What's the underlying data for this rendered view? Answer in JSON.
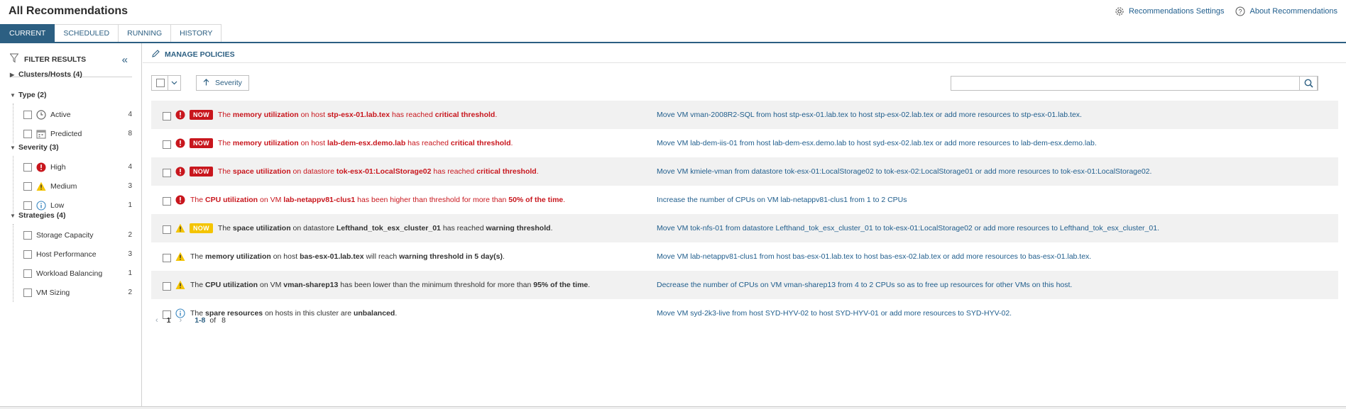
{
  "header": {
    "title": "All Recommendations",
    "settings_label": "Recommendations Settings",
    "about_label": "About Recommendations"
  },
  "tabs": [
    {
      "label": "CURRENT",
      "active": true
    },
    {
      "label": "SCHEDULED",
      "active": false
    },
    {
      "label": "RUNNING",
      "active": false
    },
    {
      "label": "HISTORY",
      "active": false
    }
  ],
  "sidebar": {
    "title": "FILTER RESULTS",
    "groups": [
      {
        "label": "Clusters/Hosts (4)",
        "expanded": false,
        "items": []
      },
      {
        "label": "Type (2)",
        "expanded": true,
        "items": [
          {
            "label": "Active",
            "count": "4",
            "icon": "clock-icon"
          },
          {
            "label": "Predicted",
            "count": "8",
            "icon": "calendar-icon"
          }
        ]
      },
      {
        "label": "Severity (3)",
        "expanded": true,
        "items": [
          {
            "label": "High",
            "count": "4",
            "icon": "error-icon"
          },
          {
            "label": "Medium",
            "count": "3",
            "icon": "warning-icon"
          },
          {
            "label": "Low",
            "count": "1",
            "icon": "info-icon"
          }
        ]
      },
      {
        "label": "Strategies (4)",
        "expanded": true,
        "items": [
          {
            "label": "Storage Capacity",
            "count": "2",
            "icon": ""
          },
          {
            "label": "Host Performance",
            "count": "3",
            "icon": ""
          },
          {
            "label": "Workload Balancing",
            "count": "1",
            "icon": ""
          },
          {
            "label": "VM Sizing",
            "count": "2",
            "icon": ""
          }
        ]
      }
    ]
  },
  "main": {
    "manage_label": "MANAGE POLICIES",
    "sort_label": "Severity",
    "search_placeholder": "",
    "colors": {
      "critical": "#c8161d",
      "warning": "#f4c400",
      "info": "#3a87c0",
      "link": "#1f5d8c"
    },
    "recommendations": [
      {
        "severity": "high",
        "badge": "NOW",
        "tone": "red",
        "parts": [
          [
            "The ",
            false
          ],
          [
            "memory utilization",
            true
          ],
          [
            " on host ",
            false
          ],
          [
            "stp-esx-01.lab.tex",
            true
          ],
          [
            " has reached ",
            false
          ],
          [
            "critical threshold",
            true
          ],
          [
            ".",
            false
          ]
        ],
        "action": "Move VM vman-2008R2-SQL from host stp-esx-01.lab.tex to host stp-esx-02.lab.tex or add more resources to stp-esx-01.lab.tex."
      },
      {
        "severity": "high",
        "badge": "NOW",
        "tone": "red",
        "parts": [
          [
            "The ",
            false
          ],
          [
            "memory utilization",
            true
          ],
          [
            " on host ",
            false
          ],
          [
            "lab-dem-esx.demo.lab",
            true
          ],
          [
            " has reached ",
            false
          ],
          [
            "critical threshold",
            true
          ],
          [
            ".",
            false
          ]
        ],
        "action": "Move VM lab-dem-iis-01 from host lab-dem-esx.demo.lab to host syd-esx-02.lab.tex or add more resources to lab-dem-esx.demo.lab."
      },
      {
        "severity": "high",
        "badge": "NOW",
        "tone": "red",
        "parts": [
          [
            "The ",
            false
          ],
          [
            "space utilization",
            true
          ],
          [
            " on datastore ",
            false
          ],
          [
            "tok-esx-01:LocalStorage02",
            true
          ],
          [
            " has reached ",
            false
          ],
          [
            "critical threshold",
            true
          ],
          [
            ".",
            false
          ]
        ],
        "action": "Move VM kmiele-vman from datastore tok-esx-01:LocalStorage02 to tok-esx-02:LocalStorage01 or add more resources to tok-esx-01:LocalStorage02."
      },
      {
        "severity": "high",
        "badge": "",
        "tone": "red",
        "parts": [
          [
            "The ",
            false
          ],
          [
            "CPU utilization",
            true
          ],
          [
            " on VM ",
            false
          ],
          [
            "lab-netappv81-clus1",
            true
          ],
          [
            " has been higher than threshold for more than ",
            false
          ],
          [
            "50% of the time",
            true
          ],
          [
            ".",
            false
          ]
        ],
        "action": "Increase the number of CPUs on VM lab-netappv81-clus1 from 1 to 2 CPUs"
      },
      {
        "severity": "medium",
        "badge": "NOW",
        "tone": "dark",
        "parts": [
          [
            "The ",
            false
          ],
          [
            "space utilization",
            true
          ],
          [
            " on datastore ",
            false
          ],
          [
            "Lefthand_tok_esx_cluster_01",
            true
          ],
          [
            " has reached ",
            false
          ],
          [
            "warning threshold",
            true
          ],
          [
            ".",
            false
          ]
        ],
        "action": "Move VM tok-nfs-01 from datastore Lefthand_tok_esx_cluster_01 to tok-esx-01:LocalStorage02 or add more resources to Lefthand_tok_esx_cluster_01."
      },
      {
        "severity": "medium",
        "badge": "",
        "tone": "dark",
        "parts": [
          [
            "The ",
            false
          ],
          [
            "memory utilization",
            true
          ],
          [
            " on host ",
            false
          ],
          [
            "bas-esx-01.lab.tex",
            true
          ],
          [
            " will reach ",
            false
          ],
          [
            "warning threshold in 5 day(s)",
            true
          ],
          [
            ".",
            false
          ]
        ],
        "action": "Move VM lab-netappv81-clus1 from host bas-esx-01.lab.tex to host bas-esx-02.lab.tex or add more resources to bas-esx-01.lab.tex."
      },
      {
        "severity": "medium",
        "badge": "",
        "tone": "dark",
        "parts": [
          [
            "The ",
            false
          ],
          [
            "CPU utilization",
            true
          ],
          [
            " on VM ",
            false
          ],
          [
            "vman-sharep13",
            true
          ],
          [
            " has been lower than the minimum threshold for more than ",
            false
          ],
          [
            "95% of the time",
            true
          ],
          [
            ".",
            false
          ]
        ],
        "action": "Decrease the number of CPUs on VM vman-sharep13 from 4 to 2 CPUs so as to free up resources for other VMs on this host."
      },
      {
        "severity": "low",
        "badge": "",
        "tone": "dark",
        "parts": [
          [
            "The ",
            false
          ],
          [
            "spare resources",
            true
          ],
          [
            " on hosts in this cluster are ",
            false
          ],
          [
            "unbalanced",
            true
          ],
          [
            ".",
            false
          ]
        ],
        "action": "Move VM syd-2k3-live from host SYD-HYV-02 to host SYD-HYV-01 or add more resources to SYD-HYV-02."
      }
    ],
    "pager": {
      "page": "1",
      "range": "1-8",
      "of_label": "of",
      "total": "8"
    }
  }
}
